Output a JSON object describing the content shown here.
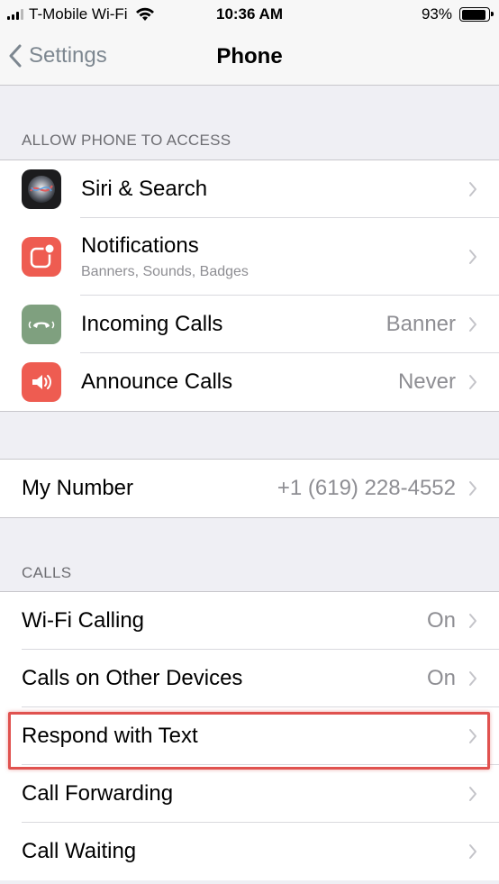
{
  "status_bar": {
    "carrier": "T-Mobile Wi-Fi",
    "time": "10:36 AM",
    "battery_text": "93%",
    "battery_level": 0.93
  },
  "nav": {
    "back_label": "Settings",
    "title": "Phone"
  },
  "sections": {
    "access_header": "ALLOW PHONE TO ACCESS",
    "calls_header": "CALLS"
  },
  "access_items": [
    {
      "title": "Siri & Search",
      "icon": "siri-icon"
    },
    {
      "title": "Notifications",
      "subtitle": "Banners, Sounds, Badges",
      "icon": "notifications-icon"
    },
    {
      "title": "Incoming Calls",
      "value": "Banner",
      "icon": "phone-icon"
    },
    {
      "title": "Announce Calls",
      "value": "Never",
      "icon": "speaker-icon"
    }
  ],
  "my_number": {
    "title": "My Number",
    "value": "+1 (619) 228-4552"
  },
  "calls_items": [
    {
      "title": "Wi-Fi Calling",
      "value": "On"
    },
    {
      "title": "Calls on Other Devices",
      "value": "On"
    },
    {
      "title": "Respond with Text"
    },
    {
      "title": "Call Forwarding"
    },
    {
      "title": "Call Waiting"
    }
  ],
  "colors": {
    "notifications_icon": "#ee5c51",
    "incoming_calls_icon": "#7fa07f",
    "announce_calls_icon": "#ee5c51",
    "highlight_border": "#e0524f"
  }
}
